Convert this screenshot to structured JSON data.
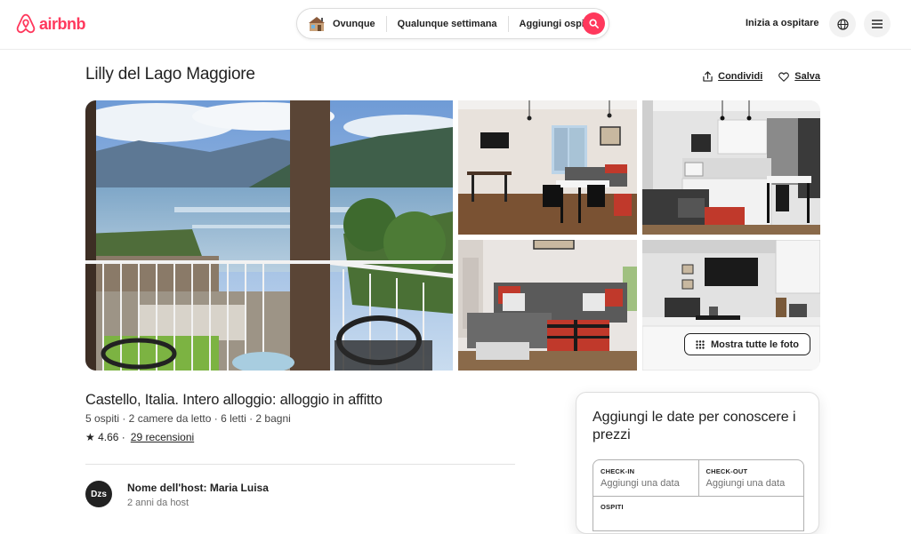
{
  "brand": {
    "name": "airbnb",
    "color": "#ff385c"
  },
  "search": {
    "where": "Ovunque",
    "when": "Qualunque settimana",
    "who": "Aggiungi ospiti",
    "icon": "search-icon"
  },
  "header": {
    "host_link": "Inizia a ospitare",
    "globe_icon": "globe-icon",
    "menu_icon": "menu-icon"
  },
  "listing": {
    "title": "Lilly del Lago Maggiore",
    "share_label": "Condividi",
    "save_label": "Salva",
    "show_all_photos": "Mostra tutte le foto",
    "subtitle": "Castello, Italia. Intero alloggio: alloggio in affitto",
    "details": "5 ospiti · 2 camere da letto · 6 letti · 2 bagni",
    "rating": "★ 4.66 ·",
    "reviews": "29 recensioni"
  },
  "host": {
    "initials": "Dzs",
    "name": "Nome dell'host: Maria Luisa",
    "since": "2 anni da host"
  },
  "booking": {
    "title": "Aggiungi le date per conoscere i prezzi",
    "checkin_label": "CHECK-IN",
    "checkin_value": "Aggiungi una data",
    "checkout_label": "CHECK-OUT",
    "checkout_value": "Aggiungi una data",
    "guests_label": "OSPITI"
  }
}
